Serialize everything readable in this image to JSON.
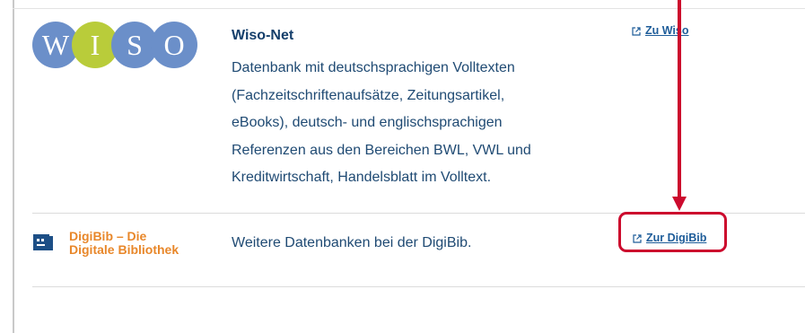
{
  "wiso": {
    "logo_letters": [
      "W",
      "I",
      "S",
      "O"
    ],
    "logo_colors": [
      "#6b8fc9",
      "#b9cc3a",
      "#6b8fc9",
      "#6b8fc9"
    ],
    "title": "Wiso-Net",
    "description_lines": [
      "Datenbank mit deutschsprachigen Volltexten",
      "(Fachzeitschriftenaufsätze, Zeitungsartikel,",
      "eBooks), deutsch- und englischsprachigen",
      "Referenzen aus den Bereichen BWL, VWL und",
      "Kreditwirtschaft, Handelsblatt im Volltext."
    ],
    "link_label": "Zu Wiso",
    "link_icon": "external-link-icon"
  },
  "digibib": {
    "logo_line1": "DigiBib – Die",
    "logo_line2": "Digitale Bibliothek",
    "logo_color": "#e8872a",
    "description": "Weitere Datenbanken bei der DigiBib.",
    "link_label": "Zur DigiBib",
    "link_icon": "external-link-icon"
  },
  "annotation": {
    "color": "#cc0a2d"
  }
}
